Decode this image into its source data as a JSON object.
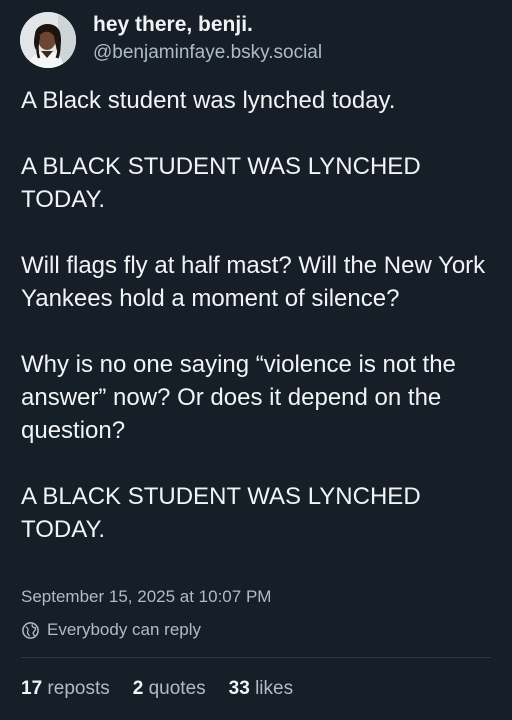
{
  "author": {
    "display_name": "hey there, benji.",
    "handle": "@benjaminfaye.bsky.social",
    "avatar_icon": "profile-photo"
  },
  "post": {
    "paragraphs": [
      "A Black student was lynched today.",
      "A BLACK STUDENT WAS LYNCHED TODAY.",
      "Will flags fly at half mast? Will the New York Yankees hold a moment of silence?",
      "Why is no one saying “violence is not the answer” now? Or does it depend on the question?",
      "A BLACK STUDENT WAS LYNCHED TODAY."
    ],
    "timestamp": "September 15, 2025 at 10:07 PM",
    "reply_setting": "Everybody can reply",
    "reply_icon": "globe-icon"
  },
  "stats": {
    "reposts_count": "17",
    "reposts_label": "reposts",
    "quotes_count": "2",
    "quotes_label": "quotes",
    "likes_count": "33",
    "likes_label": "likes"
  },
  "colors": {
    "background": "#161e27",
    "primary_text": "#f1f3f5",
    "secondary_text": "#aebbc9",
    "divider": "#2c3946"
  }
}
